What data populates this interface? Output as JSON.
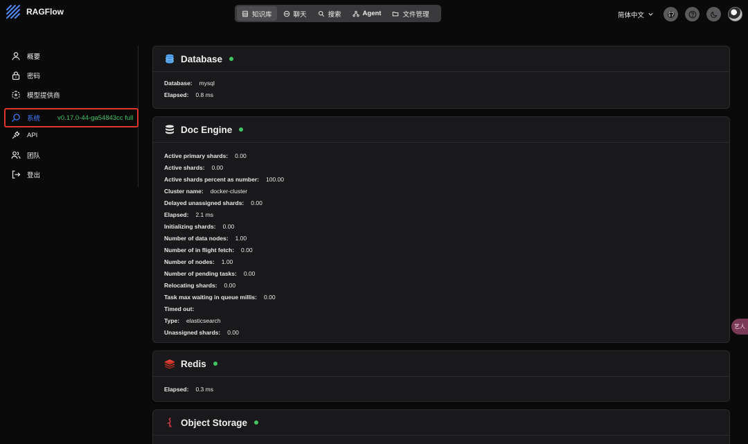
{
  "app": {
    "name": "RAGFlow"
  },
  "nav": {
    "items": [
      {
        "label": "知识库",
        "icon": "database-icon"
      },
      {
        "label": "聊天",
        "icon": "chat-icon"
      },
      {
        "label": "搜索",
        "icon": "search-icon"
      },
      {
        "label": "Agent",
        "icon": "agent-icon"
      },
      {
        "label": "文件管理",
        "icon": "folder-icon"
      }
    ]
  },
  "header": {
    "language": "简体中文"
  },
  "sidebar": {
    "items": [
      {
        "label": "概要",
        "icon": "user-icon"
      },
      {
        "label": "密码",
        "icon": "lock-icon"
      },
      {
        "label": "模型提供商",
        "icon": "box-icon"
      },
      {
        "label": "系统",
        "icon": "system-search-icon",
        "version": "v0.17.0-44-ga54843cc full",
        "active": true
      },
      {
        "label": "API",
        "icon": "plug-icon"
      },
      {
        "label": "团队",
        "icon": "team-icon"
      },
      {
        "label": "登出",
        "icon": "logout-icon"
      }
    ]
  },
  "cards": {
    "database": {
      "title": "Database",
      "status": "green",
      "rows": [
        {
          "key": "Database:",
          "value": "mysql"
        },
        {
          "key": "Elapsed:",
          "value": "0.8 ms"
        }
      ]
    },
    "doc_engine": {
      "title": "Doc Engine",
      "status": "green",
      "rows": [
        {
          "key": "Active primary shards:",
          "value": "0.00"
        },
        {
          "key": "Active shards:",
          "value": "0.00"
        },
        {
          "key": "Active shards percent as number:",
          "value": "100.00"
        },
        {
          "key": "Cluster name:",
          "value": "docker-cluster"
        },
        {
          "key": "Delayed unassigned shards:",
          "value": "0.00"
        },
        {
          "key": "Elapsed:",
          "value": "2.1 ms"
        },
        {
          "key": "Initializing shards:",
          "value": "0.00"
        },
        {
          "key": "Number of data nodes:",
          "value": "1.00"
        },
        {
          "key": "Number of in flight fetch:",
          "value": "0.00"
        },
        {
          "key": "Number of nodes:",
          "value": "1.00"
        },
        {
          "key": "Number of pending tasks:",
          "value": "0.00"
        },
        {
          "key": "Relocating shards:",
          "value": "0.00"
        },
        {
          "key": "Task max waiting in queue millis:",
          "value": "0.00"
        },
        {
          "key": "Timed out:",
          "value": ""
        },
        {
          "key": "Type:",
          "value": "elasticsearch"
        },
        {
          "key": "Unassigned shards:",
          "value": "0.00"
        }
      ]
    },
    "redis": {
      "title": "Redis",
      "status": "green",
      "rows": [
        {
          "key": "Elapsed:",
          "value": "0.3 ms"
        }
      ]
    },
    "object_storage": {
      "title": "Object Storage",
      "status": "green"
    }
  },
  "floating_tab": {
    "label": "艺人"
  },
  "colors": {
    "accent": "#3d7bf6",
    "status_ok": "#43c463",
    "highlight": "#e1342a"
  }
}
